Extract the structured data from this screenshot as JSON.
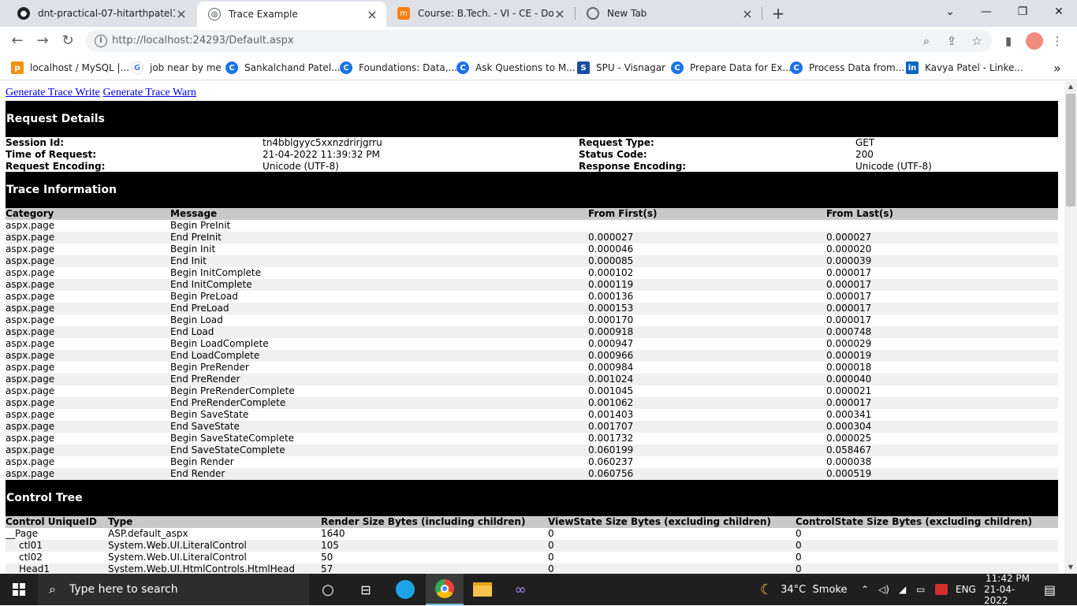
{
  "browser": {
    "tabs": [
      {
        "title": "dnt-practical-07-hitarthpatel17/c",
        "icon": "github-icon",
        "active": false
      },
      {
        "title": "Trace Example",
        "icon": "globe-icon",
        "active": true
      },
      {
        "title": "Course: B.Tech. - VI - CE - Dot Ne",
        "icon": "moodle-icon",
        "active": false
      },
      {
        "title": "New Tab",
        "icon": "chrome-icon",
        "active": false
      }
    ],
    "url": "http://localhost:24293/Default.aspx",
    "bookmarks": [
      {
        "label": "localhost / MySQL |...",
        "icon": "phpmyadmin-icon"
      },
      {
        "label": "job near by me",
        "icon": "google-icon"
      },
      {
        "label": "Sankalchand Patel...",
        "icon": "c-icon"
      },
      {
        "label": "Foundations: Data,...",
        "icon": "c-icon"
      },
      {
        "label": "Ask Questions to M...",
        "icon": "c-icon"
      },
      {
        "label": "SPU - Visnagar",
        "icon": "s-icon"
      },
      {
        "label": "Prepare Data for Ex...",
        "icon": "c-icon"
      },
      {
        "label": "Process Data from...",
        "icon": "c-icon"
      },
      {
        "label": "Kavya Patel - Linke...",
        "icon": "linkedin-icon"
      }
    ],
    "more_bookmarks": "»"
  },
  "page": {
    "link_write": "Generate Trace Write",
    "link_warn": "Generate Trace Warn",
    "request_details": {
      "title": "Request Details",
      "rows": [
        {
          "k1": "Session Id:",
          "v1": "tn4bblgyyc5xxnzdrirjgrru",
          "k2": "Request Type:",
          "v2": "GET"
        },
        {
          "k1": "Time of Request:",
          "v1": "21-04-2022 11:39:32 PM",
          "k2": "Status Code:",
          "v2": "200"
        },
        {
          "k1": "Request Encoding:",
          "v1": "Unicode (UTF-8)",
          "k2": "Response Encoding:",
          "v2": "Unicode (UTF-8)"
        }
      ]
    },
    "trace": {
      "title": "Trace Information",
      "headers": [
        "Category",
        "Message",
        "From First(s)",
        "From Last(s)"
      ],
      "rows": [
        [
          "aspx.page",
          "Begin PreInit",
          "",
          ""
        ],
        [
          "aspx.page",
          "End PreInit",
          "0.000027",
          "0.000027"
        ],
        [
          "aspx.page",
          "Begin Init",
          "0.000046",
          "0.000020"
        ],
        [
          "aspx.page",
          "End Init",
          "0.000085",
          "0.000039"
        ],
        [
          "aspx.page",
          "Begin InitComplete",
          "0.000102",
          "0.000017"
        ],
        [
          "aspx.page",
          "End InitComplete",
          "0.000119",
          "0.000017"
        ],
        [
          "aspx.page",
          "Begin PreLoad",
          "0.000136",
          "0.000017"
        ],
        [
          "aspx.page",
          "End PreLoad",
          "0.000153",
          "0.000017"
        ],
        [
          "aspx.page",
          "Begin Load",
          "0.000170",
          "0.000017"
        ],
        [
          "aspx.page",
          "End Load",
          "0.000918",
          "0.000748"
        ],
        [
          "aspx.page",
          "Begin LoadComplete",
          "0.000947",
          "0.000029"
        ],
        [
          "aspx.page",
          "End LoadComplete",
          "0.000966",
          "0.000019"
        ],
        [
          "aspx.page",
          "Begin PreRender",
          "0.000984",
          "0.000018"
        ],
        [
          "aspx.page",
          "End PreRender",
          "0.001024",
          "0.000040"
        ],
        [
          "aspx.page",
          "Begin PreRenderComplete",
          "0.001045",
          "0.000021"
        ],
        [
          "aspx.page",
          "End PreRenderComplete",
          "0.001062",
          "0.000017"
        ],
        [
          "aspx.page",
          "Begin SaveState",
          "0.001403",
          "0.000341"
        ],
        [
          "aspx.page",
          "End SaveState",
          "0.001707",
          "0.000304"
        ],
        [
          "aspx.page",
          "Begin SaveStateComplete",
          "0.001732",
          "0.000025"
        ],
        [
          "aspx.page",
          "End SaveStateComplete",
          "0.060199",
          "0.058467"
        ],
        [
          "aspx.page",
          "Begin Render",
          "0.060237",
          "0.000038"
        ],
        [
          "aspx.page",
          "End Render",
          "0.060756",
          "0.000519"
        ]
      ]
    },
    "control_tree": {
      "title": "Control Tree",
      "headers": [
        "Control UniqueID",
        "Type",
        "Render Size Bytes (including children)",
        "ViewState Size Bytes (excluding children)",
        "ControlState Size Bytes (excluding children)"
      ],
      "rows": [
        [
          "__Page",
          "ASP.default_aspx",
          "1640",
          "0",
          "0"
        ],
        [
          "ctl01",
          "System.Web.UI.LiteralControl",
          "105",
          "0",
          "0"
        ],
        [
          "ctl02",
          "System.Web.UI.LiteralControl",
          "50",
          "0",
          "0"
        ],
        [
          "Head1",
          "System.Web.UI.HtmlControls.HtmlHead",
          "57",
          "0",
          "0"
        ]
      ]
    }
  },
  "taskbar": {
    "search_placeholder": "Type here to search",
    "weather": "34°C  Smoke",
    "lang": "ENG",
    "time": "11:42 PM",
    "date": "21-04-2022"
  },
  "colors": {
    "section_bg": "#000000",
    "header_row_bg": "#c8c8c8",
    "alt_row_bg": "#f0f0f0",
    "link": "#0000ee"
  }
}
